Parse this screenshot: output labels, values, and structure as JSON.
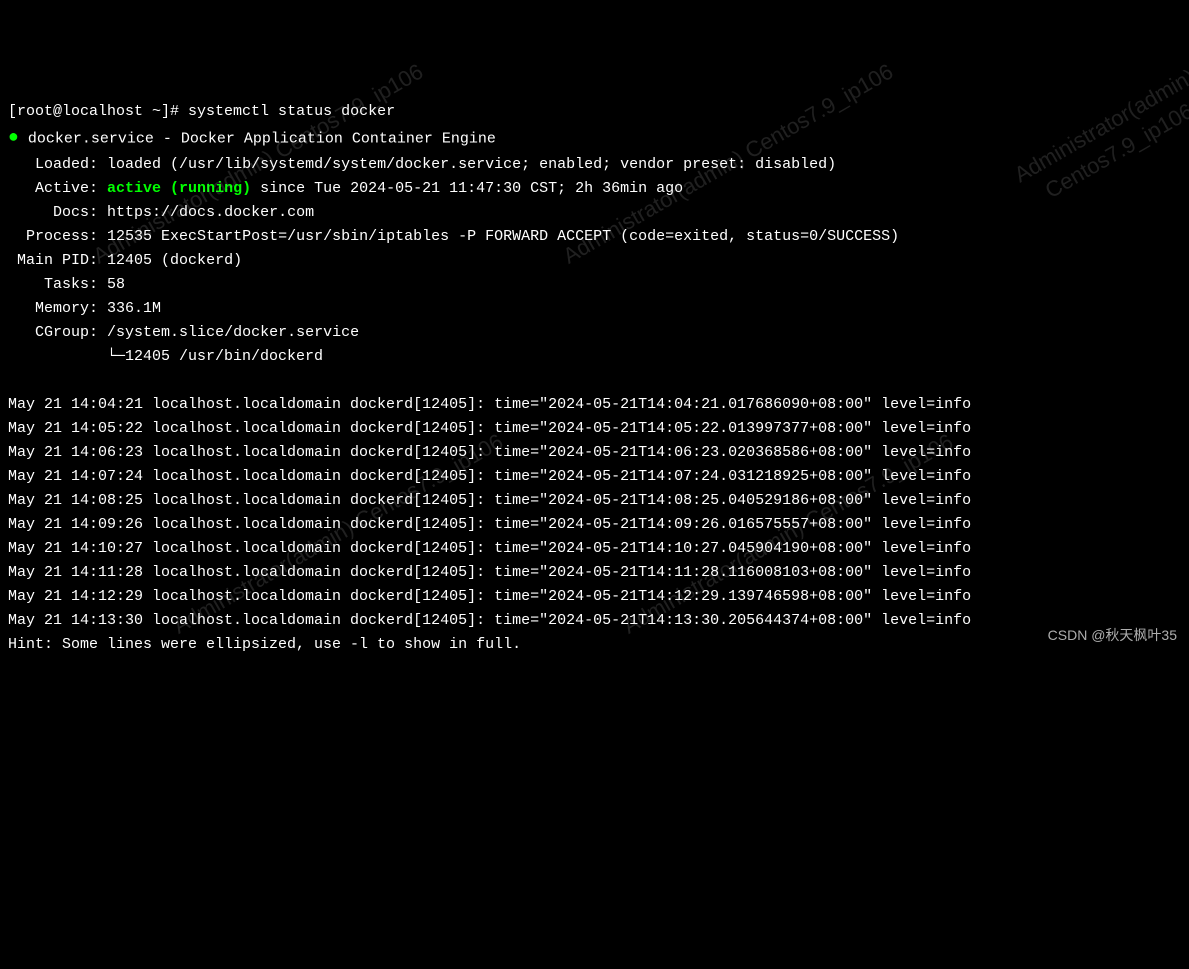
{
  "prompt": {
    "user_host": "[root@localhost ~]#",
    "command": "systemctl status docker"
  },
  "service": {
    "name": "docker.service",
    "sep": " - ",
    "desc": "Docker Application Container Engine"
  },
  "loaded": {
    "label": "Loaded:",
    "value": "loaded (/usr/lib/systemd/system/docker.service; enabled; vendor preset: disabled)"
  },
  "active": {
    "label": "Active:",
    "status": "active (running)",
    "since": " since Tue 2024-05-21 11:47:30 CST; 2h 36min ago"
  },
  "docs": {
    "label": "Docs:",
    "value": "https://docs.docker.com"
  },
  "process": {
    "label": "Process:",
    "value": "12535 ExecStartPost=/usr/sbin/iptables -P FORWARD ACCEPT (code=exited, status=0/SUCCESS)"
  },
  "mainpid": {
    "label": "Main PID:",
    "value": "12405 (dockerd)"
  },
  "tasks": {
    "label": "Tasks:",
    "value": "58"
  },
  "memory": {
    "label": "Memory:",
    "value": "336.1M"
  },
  "cgroup": {
    "label": "CGroup:",
    "value": "/system.slice/docker.service",
    "tree_prefix": "           └─",
    "tree_value": "12405 /usr/bin/dockerd"
  },
  "logs": [
    "May 21 14:04:21 localhost.localdomain dockerd[12405]: time=\"2024-05-21T14:04:21.017686090+08:00\" level=info",
    "May 21 14:05:22 localhost.localdomain dockerd[12405]: time=\"2024-05-21T14:05:22.013997377+08:00\" level=info",
    "May 21 14:06:23 localhost.localdomain dockerd[12405]: time=\"2024-05-21T14:06:23.020368586+08:00\" level=info",
    "May 21 14:07:24 localhost.localdomain dockerd[12405]: time=\"2024-05-21T14:07:24.031218925+08:00\" level=info",
    "May 21 14:08:25 localhost.localdomain dockerd[12405]: time=\"2024-05-21T14:08:25.040529186+08:00\" level=info",
    "May 21 14:09:26 localhost.localdomain dockerd[12405]: time=\"2024-05-21T14:09:26.016575557+08:00\" level=info",
    "May 21 14:10:27 localhost.localdomain dockerd[12405]: time=\"2024-05-21T14:10:27.045904190+08:00\" level=info",
    "May 21 14:11:28 localhost.localdomain dockerd[12405]: time=\"2024-05-21T14:11:28.116008103+08:00\" level=info",
    "May 21 14:12:29 localhost.localdomain dockerd[12405]: time=\"2024-05-21T14:12:29.139746598+08:00\" level=info",
    "May 21 14:13:30 localhost.localdomain dockerd[12405]: time=\"2024-05-21T14:13:30.205644374+08:00\" level=info"
  ],
  "hint": "Hint: Some lines were ellipsized, use -l to show in full.",
  "watermark": "CSDN @秋天枫叶35",
  "diag_watermark": "Administrator(admin)\nCentos7.9_ip106"
}
